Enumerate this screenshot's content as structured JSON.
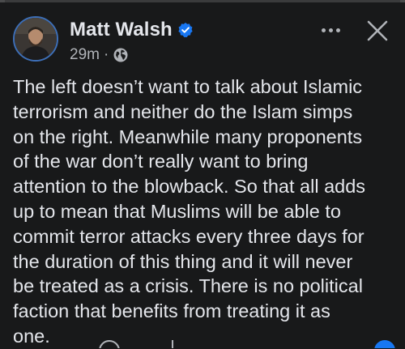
{
  "post": {
    "author": "Matt Walsh",
    "timestamp": "29m",
    "separator": "·",
    "privacy_icon": "globe-icon",
    "verified_icon": "verified-badge-icon",
    "more_icon": "more-options-icon",
    "close_icon": "close-icon",
    "text": "The left doesn’t want to talk about Islamic\nterrorism and neither do the Islam simps\non the right. Meanwhile many proponents\nof the war don’t really want to bring\nattention to the blowback. So that all adds\nup to mean that Muslims will be able to\ncommit terror attacks every three days for\nthe duration of this thing and it will never\nbe treated as a crisis. There is no political\nfaction that benefits from treating it as\none."
  },
  "colors": {
    "background": "#18191a",
    "text": "#e4e6eb",
    "secondary_text": "#b0b3b8",
    "verified_blue": "#1877f2"
  }
}
